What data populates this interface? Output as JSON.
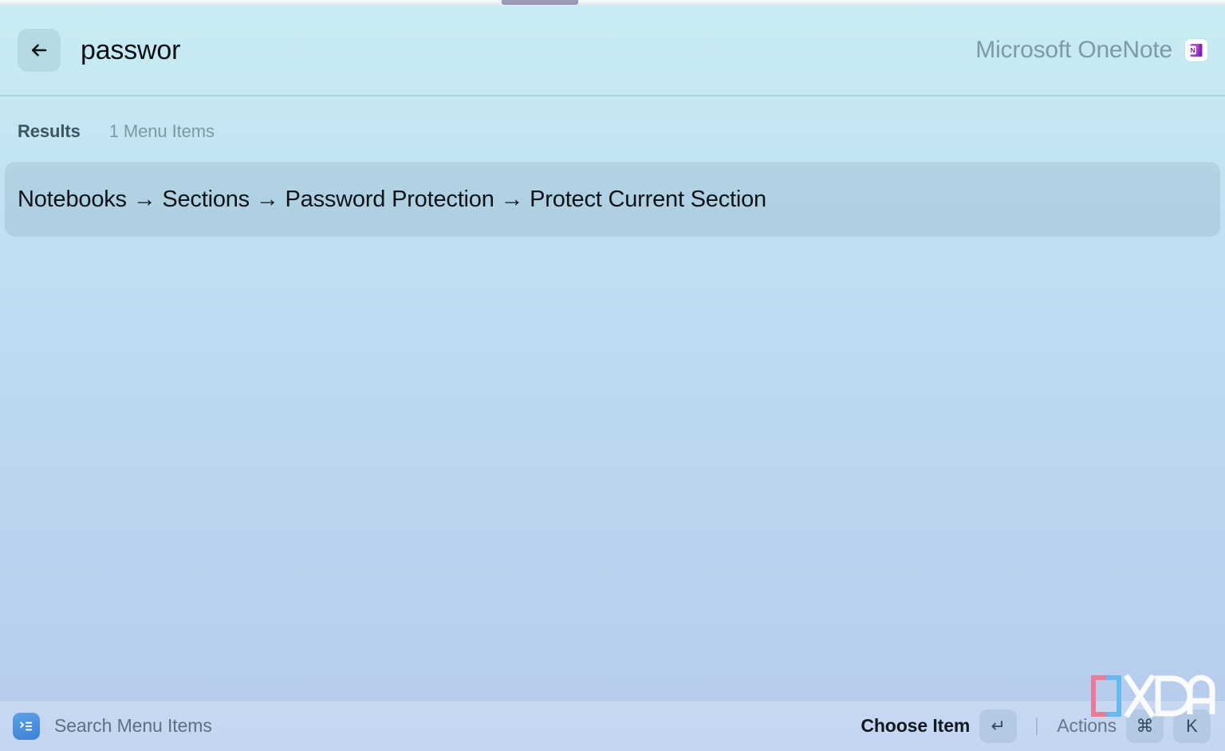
{
  "header": {
    "back_icon": "arrow-left-icon",
    "query": "passwor",
    "app_name": "Microsoft OneNote",
    "app_icon": "onenote-icon"
  },
  "results": {
    "section_label": "Results",
    "count_label": "1 Menu Items",
    "items": [
      {
        "path": "Notebooks → Sections → Password Protection → Protect Current Section",
        "selected": true
      }
    ]
  },
  "footer": {
    "app_icon": "menu-items-icon",
    "hint": "Search Menu Items",
    "primary_action": "Choose Item",
    "primary_key": "↵",
    "secondary_action": "Actions",
    "secondary_key_modifier": "⌘",
    "secondary_key": "K"
  },
  "watermark": {
    "text": "XDA"
  },
  "colors": {
    "background_top": "#c9edf3",
    "background_bottom": "#b7cbee",
    "selected_row": "#9fc2d4",
    "accent_blue": "#3d7fd4",
    "onenote_purple": "#7719aa",
    "text_primary": "#0e141a",
    "text_muted": "#7d9aa4"
  }
}
